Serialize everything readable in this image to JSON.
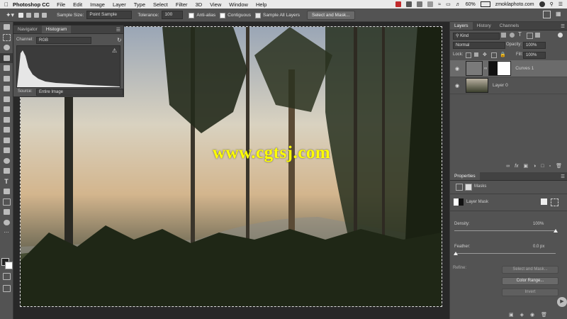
{
  "menubar": {
    "app_name": "Photoshop CC",
    "items": [
      "File",
      "Edit",
      "Image",
      "Layer",
      "Type",
      "Select",
      "Filter",
      "3D",
      "View",
      "Window",
      "Help"
    ],
    "battery": "60%",
    "account": "zmoklaphoto.com"
  },
  "options": {
    "sample_size_label": "Sample Size:",
    "sample_size_value": "Point Sample",
    "tolerance_label": "Tolerance:",
    "tolerance_value": "100",
    "anti_alias_label": "Anti-alias",
    "contiguous_label": "Contiguous",
    "sample_all_label": "Sample All Layers",
    "select_mask_label": "Select and Mask..."
  },
  "histogram": {
    "tab_navigator": "Navigator",
    "tab_histogram": "Histogram",
    "channel_label": "Channel:",
    "channel_value": "RGB",
    "source_label": "Source:",
    "source_value": "Entire Image"
  },
  "watermark": "www.cgtsj.com",
  "layers": {
    "tab_layers": "Layers",
    "tab_history": "History",
    "tab_channels": "Channels",
    "kind_label": "Kind",
    "blend_mode": "Normal",
    "opacity_label": "Opacity:",
    "opacity_value": "100%",
    "lock_label": "Lock:",
    "fill_label": "Fill:",
    "fill_value": "100%",
    "items": [
      {
        "name": "Curves 1"
      },
      {
        "name": "Layer 0"
      }
    ]
  },
  "properties": {
    "title": "Properties",
    "masks_label": "Masks",
    "layer_mask_label": "Layer Mask",
    "density_label": "Density:",
    "density_value": "100%",
    "density_fraction": 1.0,
    "feather_label": "Feather:",
    "feather_value": "0.0 px",
    "feather_fraction": 0.0,
    "refine_label": "Refine:",
    "select_mask_button": "Select and Mask...",
    "color_range_button": "Color Range...",
    "invert_button": "Invert"
  },
  "colors": {
    "menubar_bg": "#e9e9e9",
    "panel_bg": "#535353",
    "dark_bg": "#282828",
    "watermark": "#ffff00"
  }
}
